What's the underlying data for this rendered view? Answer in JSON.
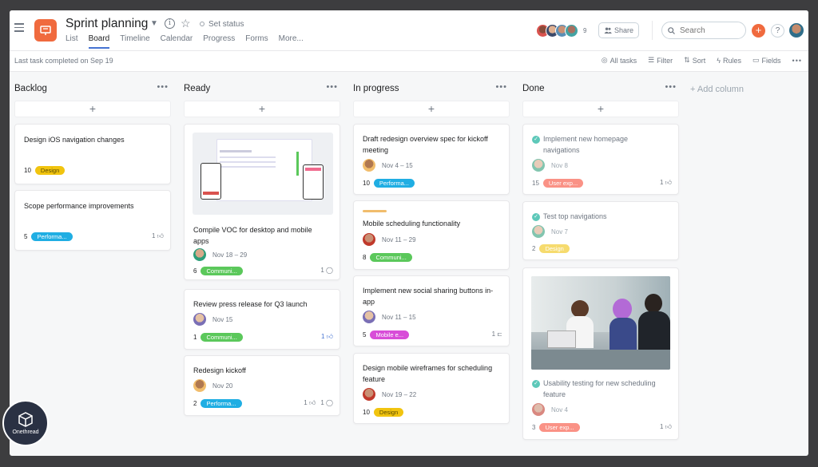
{
  "header": {
    "project_title": "Sprint planning",
    "set_status": "Set status",
    "tabs": [
      "List",
      "Board",
      "Timeline",
      "Calendar",
      "Progress",
      "Forms",
      "More..."
    ],
    "member_count": "9",
    "share_label": "Share",
    "search_placeholder": "Search",
    "help_label": "?"
  },
  "subbar": {
    "last_task": "Last task completed on Sep 19",
    "all_tasks": "All tasks",
    "filter": "Filter",
    "sort": "Sort",
    "rules": "Rules",
    "fields": "Fields"
  },
  "colors": {
    "accent": "#4573d2",
    "brand": "#f06a3e",
    "design": "#f1c40f",
    "performance": "#20aee3",
    "communication": "#5bc85b",
    "mobile": "#d84dd8",
    "user_exp": "#fa8072",
    "complete": "#5dc8b9"
  },
  "columns": [
    {
      "title": "Backlog",
      "cards": [
        {
          "title": "Design iOS navigation changes",
          "num": "10",
          "tag": "Design"
        },
        {
          "title": "Scope performance improvements",
          "num": "5",
          "tag": "Performa...",
          "likes": "1"
        }
      ]
    },
    {
      "title": "Ready",
      "cards": [
        {
          "title": "Compile VOC for desktop and mobile apps",
          "date": "Nov 18 – 29",
          "num": "6",
          "tag": "Communi...",
          "comments": "1"
        },
        {
          "title": "Review press release for Q3 launch",
          "date": "Nov 15",
          "num": "1",
          "tag": "Communi...",
          "likes": "1"
        },
        {
          "title": "Redesign kickoff",
          "date": "Nov 20",
          "num": "2",
          "tag": "Performa...",
          "likes": "1",
          "comments": "1"
        }
      ]
    },
    {
      "title": "In progress",
      "cards": [
        {
          "title": "Draft redesign overview spec for kickoff meeting",
          "date": "Nov 4 – 15",
          "num": "10",
          "tag": "Performa..."
        },
        {
          "title": "Mobile scheduling functionality",
          "date": "Nov 11 – 29",
          "num": "8",
          "tag": "Communi..."
        },
        {
          "title": "Implement new social sharing buttons in-app",
          "date": "Nov 11 – 15",
          "num": "5",
          "tag": "Mobile e...",
          "subtasks": "1"
        },
        {
          "title": "Design mobile wireframes for scheduling feature",
          "date": "Nov 19 – 22",
          "num": "10",
          "tag": "Design"
        }
      ]
    },
    {
      "title": "Done",
      "cards": [
        {
          "title": "Implement new homepage navigations",
          "date": "Nov 8",
          "num": "15",
          "tag": "User exp...",
          "likes": "1"
        },
        {
          "title": "Test top navigations",
          "date": "Nov 7",
          "num": "2",
          "tag": "Design"
        },
        {
          "title": "Usability testing for new scheduling feature",
          "date": "Nov 4",
          "num": "3",
          "tag": "User exp...",
          "likes": "1"
        }
      ]
    }
  ],
  "add_column": "+ Add column",
  "badge": {
    "label": "Onethread"
  }
}
